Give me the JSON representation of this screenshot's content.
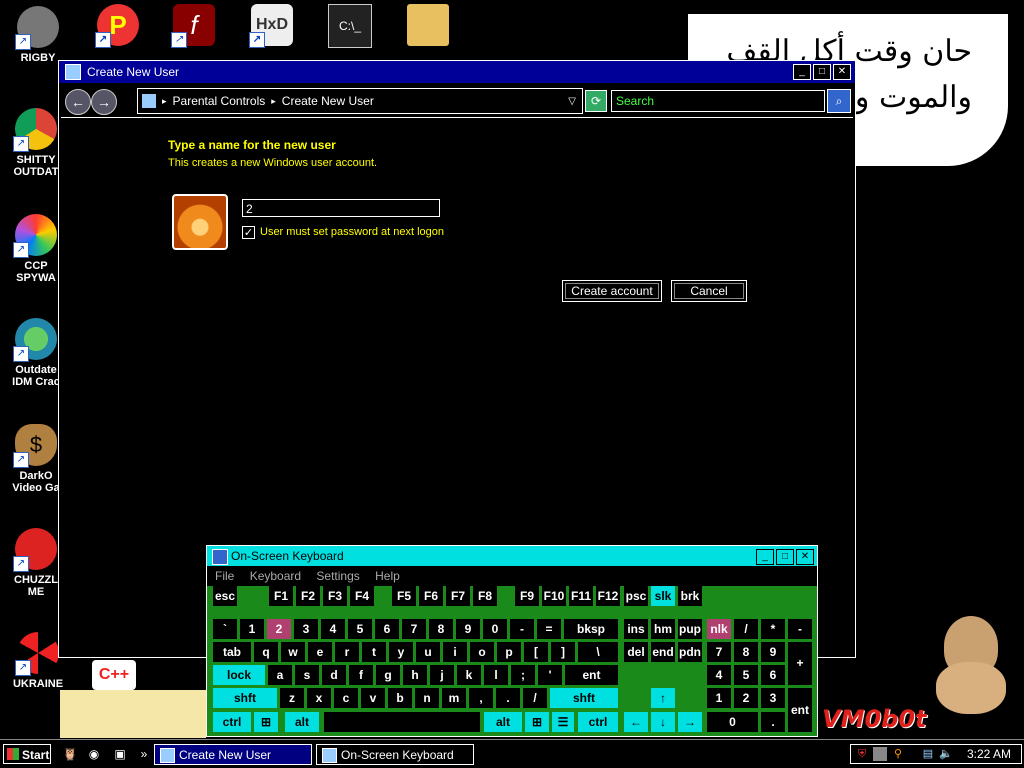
{
  "desktop": {
    "icons": [
      {
        "label": "RIGBY",
        "name": "rigby-shortcut"
      },
      {
        "label": "SHITTY\nOUTDAT",
        "name": "chrome-shortcut"
      },
      {
        "label": "CCP\nSPYWA",
        "name": "ccp-spyware-shortcut"
      },
      {
        "label": "Outdate\nIDM Crac",
        "name": "idm-shortcut"
      },
      {
        "label": "DarkO\nVideo Ga",
        "name": "darko-shortcut"
      },
      {
        "label": "CHUZZL\nME",
        "name": "chuzzle-shortcut"
      },
      {
        "label": "UKRAINE",
        "name": "ukraine-shortcut"
      }
    ],
    "bubble_lines": [
      "حان وقت أكل القف",
      "والموت وتد"
    ],
    "watermark": "VM0b0t"
  },
  "window": {
    "title": "Create New User",
    "breadcrumb": [
      "Parental Controls",
      "Create New User"
    ],
    "search_placeholder": "Search",
    "heading": "Type a name for the new user",
    "subheading": "This creates a new Windows user account.",
    "name_value": "2",
    "checkbox_label": "User must set password at next logon",
    "checkbox_checked": true,
    "create_button": "Create account",
    "cancel_button": "Cancel"
  },
  "osk": {
    "title": "On-Screen Keyboard",
    "menu": [
      "File",
      "Keyboard",
      "Settings",
      "Help"
    ],
    "keys": {
      "esc": "esc",
      "f1": "F1",
      "f2": "F2",
      "f3": "F3",
      "f4": "F4",
      "f5": "F5",
      "f6": "F6",
      "f7": "F7",
      "f8": "F8",
      "f9": "F9",
      "f10": "F10",
      "f11": "F11",
      "f12": "F12",
      "psc": "psc",
      "slk": "slk",
      "brk": "brk",
      "backtick": "`",
      "k1": "1",
      "k2": "2",
      "k3": "3",
      "k4": "4",
      "k5": "5",
      "k6": "6",
      "k7": "7",
      "k8": "8",
      "k9": "9",
      "k0": "0",
      "minus": "-",
      "equals": "=",
      "bksp": "bksp",
      "ins": "ins",
      "hm": "hm",
      "pup": "pup",
      "nlk": "nlk",
      "ndiv": "/",
      "nmul": "*",
      "nsub": "-",
      "tab": "tab",
      "q": "q",
      "w": "w",
      "e": "e",
      "r": "r",
      "t": "t",
      "y": "y",
      "u": "u",
      "i": "i",
      "o": "o",
      "p": "p",
      "lbr": "[",
      "rbr": "]",
      "bslash": "\\",
      "del": "del",
      "end": "end",
      "pdn": "pdn",
      "n7": "7",
      "n8": "8",
      "n9": "9",
      "nadd": "+",
      "lock": "lock",
      "a": "a",
      "s": "s",
      "d": "d",
      "f": "f",
      "g": "g",
      "h": "h",
      "j": "j",
      "k": "k",
      "l": "l",
      "semi": ";",
      "quote": "'",
      "ent": "ent",
      "n4": "4",
      "n5": "5",
      "n6": "6",
      "lshft": "shft",
      "z": "z",
      "x": "x",
      "c": "c",
      "v": "v",
      "b": "b",
      "n": "n",
      "m": "m",
      "comma": ",",
      "period": ".",
      "slash": "/",
      "rshft": "shft",
      "up": "↑",
      "n1": "1",
      "n2": "2",
      "n3": "3",
      "lctrl": "ctrl",
      "lalt": "alt",
      "ralt": "alt",
      "rctrl": "ctrl",
      "left": "←",
      "down": "↓",
      "right": "→",
      "n0": "0",
      "ndot": ".",
      "nent": "ent"
    }
  },
  "taskbar": {
    "start": "Start",
    "items": [
      "Create New User",
      "On-Screen Keyboard"
    ],
    "clock": "3:22 AM"
  }
}
